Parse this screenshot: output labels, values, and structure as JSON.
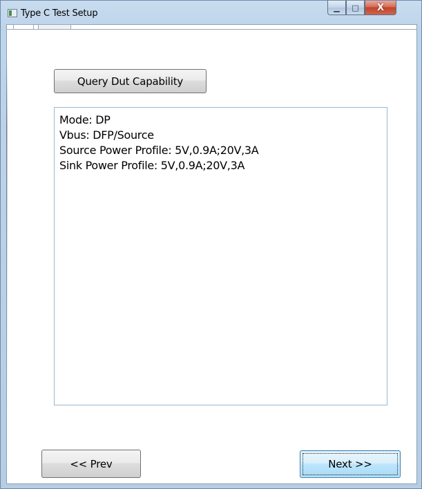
{
  "window": {
    "title": "Type C Test Setup",
    "icon": "app-window-icon",
    "controls": {
      "minimize_glyph": "▁",
      "maximize_glyph": "□",
      "close_glyph": "X"
    }
  },
  "tabs": [
    {
      "label": ""
    },
    {
      "label": ""
    }
  ],
  "actions": {
    "query_label": "Query Dut Capability",
    "prev_label": "<< Prev",
    "next_label": "Next >>"
  },
  "capability": {
    "lines": [
      "Mode: DP",
      "Vbus: DFP/Source",
      "Source Power Profile: 5V,0.9A;20V,3A",
      "Sink Power Profile: 5V,0.9A;20V,3A"
    ]
  },
  "colors": {
    "frame": "#bed4ea",
    "close_button": "#c0432c",
    "default_button_border": "#3c7fb1"
  }
}
